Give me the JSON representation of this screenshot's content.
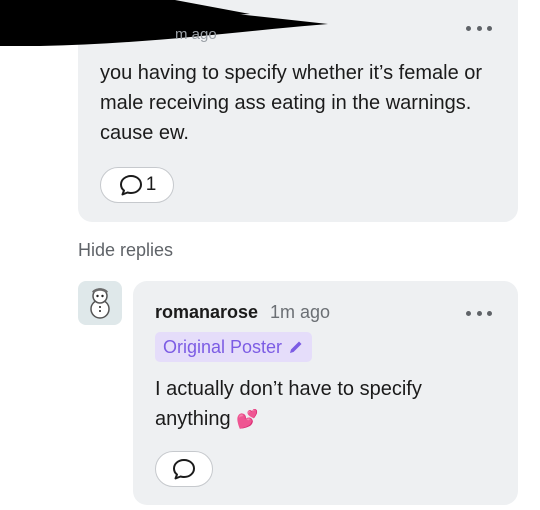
{
  "first_comment": {
    "meta_faint": "m ago",
    "text": "you having to specify whether it’s female or male receiving ass eating in the warnings. cause ew.",
    "reply_count": "1",
    "icons": {
      "more": "more-horizontal-icon",
      "reply": "speech-bubble-icon"
    }
  },
  "thread": {
    "hide_replies_label": "Hide replies"
  },
  "reply": {
    "username": "romanarose",
    "time": "1m ago",
    "badge_label": "Original Poster",
    "text": "I actually don’t have to specify anything",
    "emoji": "💕",
    "icons": {
      "more": "more-horizontal-icon",
      "reply": "speech-bubble-icon",
      "badge": "pencil-icon",
      "avatar": "snowman-avatar"
    }
  },
  "colors": {
    "card_bg": "#eef0f2",
    "badge_bg": "#e5ddfa",
    "badge_text": "#7c5ce4",
    "redaction": "#000000"
  }
}
